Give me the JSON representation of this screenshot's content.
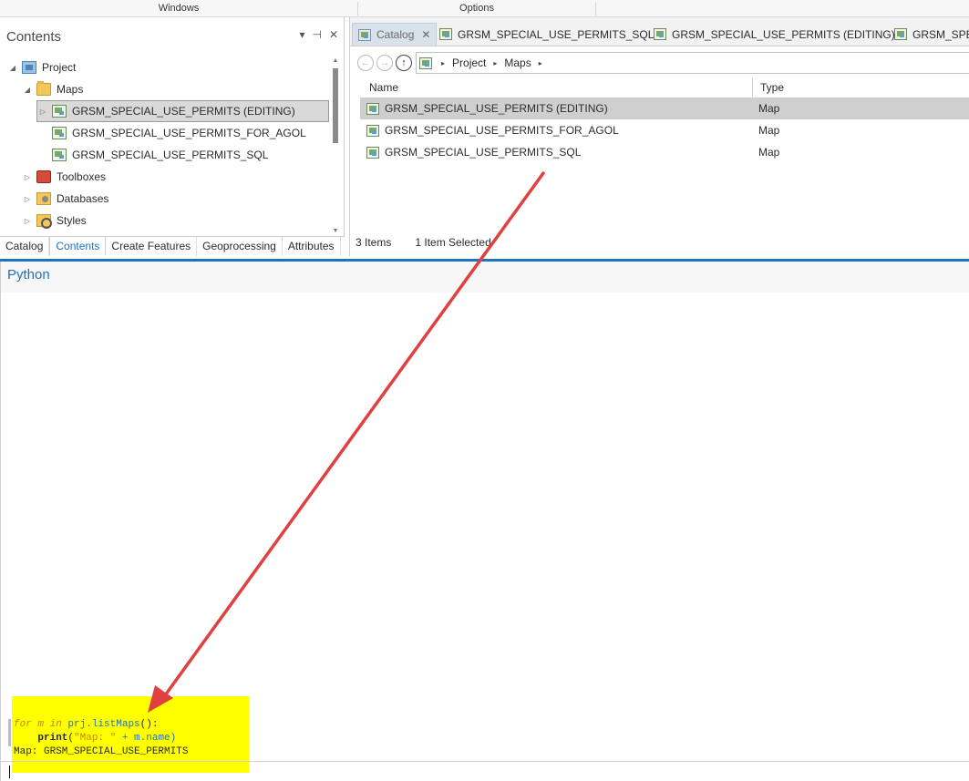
{
  "ribbon": {
    "groups": [
      "Windows",
      "Options"
    ]
  },
  "contents_pane": {
    "title": "Contents",
    "controls": {
      "menu": "▾",
      "pin": "⊣",
      "close": "✕"
    },
    "tree": [
      {
        "label": "Project",
        "icon": "project-icon",
        "arrow": "◢"
      },
      {
        "label": "Maps",
        "icon": "folder-icon",
        "arrow": "◢"
      },
      {
        "label": "GRSM_SPECIAL_USE_PERMITS (EDITING)",
        "icon": "map-icon",
        "arrow": "▷",
        "selected": true
      },
      {
        "label": "GRSM_SPECIAL_USE_PERMITS_FOR_AGOL",
        "icon": "map-icon",
        "arrow": ""
      },
      {
        "label": "GRSM_SPECIAL_USE_PERMITS_SQL",
        "icon": "map-icon",
        "arrow": ""
      },
      {
        "label": "Toolboxes",
        "icon": "toolbox-icon",
        "arrow": "▷"
      },
      {
        "label": "Databases",
        "icon": "database-icon",
        "arrow": "▷"
      },
      {
        "label": "Styles",
        "icon": "styles-icon",
        "arrow": "▷"
      }
    ],
    "tabs": [
      "Catalog",
      "Contents",
      "Create Features",
      "Geoprocessing",
      "Attributes"
    ],
    "active_tab": "Contents"
  },
  "catalog_view": {
    "doc_tabs": [
      {
        "label": "Catalog",
        "close": "✕",
        "active": true
      },
      {
        "label": "GRSM_SPECIAL_USE_PERMITS_SQL"
      },
      {
        "label": "GRSM_SPECIAL_USE_PERMITS (EDITING)"
      },
      {
        "label": "GRSM_SPEC"
      }
    ],
    "nav": {
      "back": "←",
      "forward": "→",
      "up": "↑"
    },
    "breadcrumb": [
      "Project",
      "Maps"
    ],
    "breadcrumb_sep": "▸",
    "columns": [
      "Name",
      "Type"
    ],
    "rows": [
      {
        "name": "GRSM_SPECIAL_USE_PERMITS (EDITING)",
        "type": "Map",
        "selected": true
      },
      {
        "name": "GRSM_SPECIAL_USE_PERMITS_FOR_AGOL",
        "type": "Map"
      },
      {
        "name": "GRSM_SPECIAL_USE_PERMITS_SQL",
        "type": "Map"
      }
    ],
    "status": {
      "items": "3 Items",
      "selected": "1 Item Selected"
    }
  },
  "python_pane": {
    "title": "Python",
    "code": {
      "line1_kw": "for",
      "line1_var": " m ",
      "line1_in": "in",
      "line1_call": " prj.listMaps",
      "line1_end": "():",
      "line2_indent": "    ",
      "line2_fn": "print",
      "line2_open": "(",
      "line2_str": "\"Map: \"",
      "line2_rest": " + m.name)",
      "output": "Map: GRSM_SPECIAL_USE_PERMITS"
    }
  },
  "colors": {
    "accent": "#1e73be",
    "highlight": "#ffff00",
    "annotation_arrow": "#e04040"
  }
}
